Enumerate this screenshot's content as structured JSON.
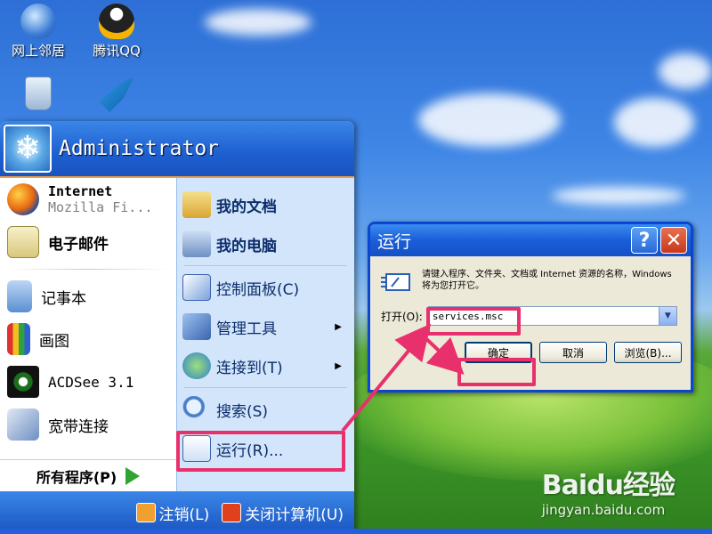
{
  "desktop": {
    "icons": [
      {
        "label": "网上邻居",
        "icon": "network-globe-icon"
      },
      {
        "label": "腾讯QQ",
        "icon": "qq-penguin-icon"
      },
      {
        "label": "",
        "icon": "recycle-bin-icon"
      },
      {
        "label": "",
        "icon": "bird-app-icon"
      }
    ]
  },
  "start_menu": {
    "user_name": "Administrator",
    "left_items": [
      {
        "main": "Internet",
        "sub": "Mozilla Fi...",
        "icon": "firefox-icon"
      },
      {
        "main": "电子邮件",
        "icon": "email-icon"
      },
      {
        "main": "记事本",
        "icon": "notepad-icon"
      },
      {
        "main": "画图",
        "icon": "paint-icon"
      },
      {
        "main": "ACDSee 3.1",
        "icon": "acdsee-eye-icon"
      },
      {
        "main": "宽带连接",
        "icon": "broadband-icon"
      }
    ],
    "all_programs": "所有程序(P)",
    "right_items": [
      {
        "label": "我的文档",
        "icon": "my-documents-icon"
      },
      {
        "label": "我的电脑",
        "icon": "my-computer-icon"
      },
      {
        "label": "控制面板(C)",
        "icon": "control-panel-icon"
      },
      {
        "label": "管理工具",
        "icon": "admin-tools-icon"
      },
      {
        "label": "连接到(T)",
        "icon": "connect-to-icon"
      },
      {
        "label": "搜索(S)",
        "icon": "search-icon"
      },
      {
        "label": "运行(R)...",
        "icon": "run-icon"
      }
    ],
    "footer": {
      "logoff": "注销(L)",
      "shutdown": "关闭计算机(U)"
    }
  },
  "run_dialog": {
    "title": "运行",
    "help_glyph": "?",
    "close_glyph": "✕",
    "description": "请键入程序、文件夹、文档或 Internet 资源的名称，Windows 将为您打开它。",
    "open_label": "打开(O):",
    "open_value": "services.msc",
    "buttons": {
      "ok": "确定",
      "cancel": "取消",
      "browse": "浏览(B)..."
    }
  },
  "watermark": {
    "logo": "Baidu经验",
    "url": "jingyan.baidu.com"
  },
  "colors": {
    "highlight": "#e8316c",
    "xp_blue": "#1a54c0",
    "dialog_face": "#ece9d8"
  }
}
